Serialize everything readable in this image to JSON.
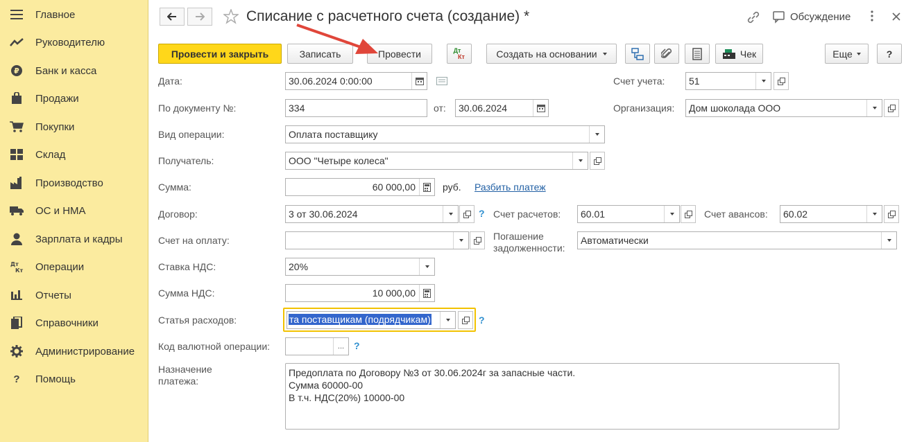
{
  "sidebar": {
    "items": [
      {
        "label": "Главное",
        "icon": "hamburger-icon"
      },
      {
        "label": "Руководителю",
        "icon": "trend-icon"
      },
      {
        "label": "Банк и касса",
        "icon": "ruble-icon"
      },
      {
        "label": "Продажи",
        "icon": "shopping-bag-icon"
      },
      {
        "label": "Покупки",
        "icon": "cart-icon"
      },
      {
        "label": "Склад",
        "icon": "warehouse-icon"
      },
      {
        "label": "Производство",
        "icon": "factory-icon"
      },
      {
        "label": "ОС и НМА",
        "icon": "truck-icon"
      },
      {
        "label": "Зарплата и кадры",
        "icon": "person-icon"
      },
      {
        "label": "Операции",
        "icon": "dt-kt-icon"
      },
      {
        "label": "Отчеты",
        "icon": "bar-chart-icon"
      },
      {
        "label": "Справочники",
        "icon": "books-icon"
      },
      {
        "label": "Администрирование",
        "icon": "gear-icon"
      },
      {
        "label": "Помощь",
        "icon": "question-icon"
      }
    ]
  },
  "header": {
    "title": "Списание с расчетного счета (создание) *",
    "discussion": "Обсуждение"
  },
  "toolbar": {
    "post_close": "Провести и закрыть",
    "save": "Записать",
    "post": "Провести",
    "dtkt_top": "Дт",
    "dtkt_bottom": "Кт",
    "create_based": "Создать на основании",
    "receipt": "Чек",
    "more": "Еще",
    "help": "?"
  },
  "form": {
    "date_label": "Дата:",
    "date_value": "30.06.2024  0:00:00",
    "account_label": "Счет учета:",
    "account_value": "51",
    "doc_no_label": "По документу №:",
    "doc_no_value": "334",
    "from_label": "от:",
    "from_value": "30.06.2024",
    "org_label": "Организация:",
    "org_value": "Дом шоколада ООО",
    "op_type_label": "Вид операции:",
    "op_type_value": "Оплата поставщику",
    "recipient_label": "Получатель:",
    "recipient_value": "ООО \"Четыре колеса\"",
    "sum_label": "Сумма:",
    "sum_value": "60 000,00",
    "currency": "руб.",
    "split_link": "Разбить платеж",
    "contract_label": "Договор:",
    "contract_value": "3 от 30.06.2024",
    "settle_acc_label": "Счет расчетов:",
    "settle_acc_value": "60.01",
    "advance_acc_label": "Счет авансов:",
    "advance_acc_value": "60.02",
    "invoice_label": "Счет на оплату:",
    "invoice_value": "",
    "repay_label_1": "Погашение",
    "repay_label_2": "задолженности:",
    "repay_value": "Автоматически",
    "vat_rate_label": "Ставка НДС:",
    "vat_rate_value": "20%",
    "vat_sum_label": "Сумма НДС:",
    "vat_sum_value": "10 000,00",
    "expense_label": "Статья расходов:",
    "expense_value": "та поставщикам (подрядчикам)",
    "currency_op_label": "Код валютной операции:",
    "currency_op_value": "",
    "purpose_label_1": "Назначение",
    "purpose_label_2": "платежа:",
    "purpose_lines": [
      "Предоплата по Договору №3 от 30.06.2024г за запасные части.",
      "Сумма 60000-00",
      "В т.ч. НДС(20%) 10000-00"
    ],
    "question": "?",
    "ellipsis": "..."
  },
  "colors": {
    "sidebar_bg": "#fbeb9f",
    "primary_button": "#ffd71a",
    "link": "#2361a5",
    "selection": "#3366cc",
    "focus_border": "#f2c200",
    "annotation_arrow": "#e0463a"
  }
}
